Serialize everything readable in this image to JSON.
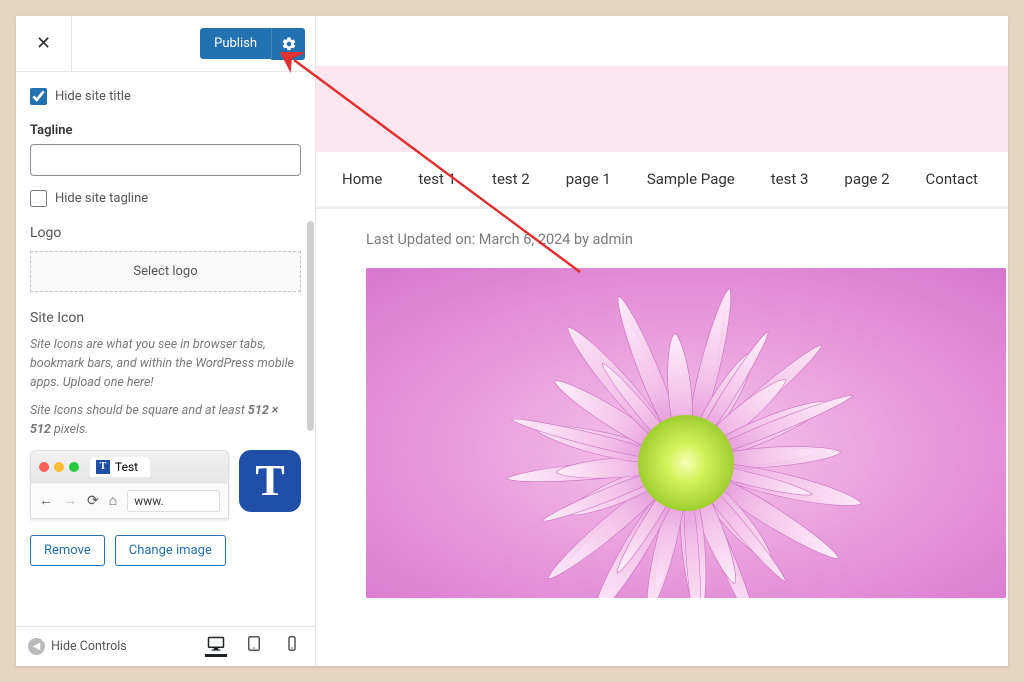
{
  "topbar": {
    "publish_label": "Publish"
  },
  "panel": {
    "hide_title_label": "Hide site title",
    "hide_title_checked": true,
    "tagline_label": "Tagline",
    "tagline_value": "",
    "hide_tagline_label": "Hide site tagline",
    "hide_tagline_checked": false,
    "logo_label": "Logo",
    "select_logo_label": "Select logo",
    "site_icon_label": "Site Icon",
    "site_icon_desc1": "Site Icons are what you see in browser tabs, bookmark bars, and within the WordPress mobile apps. Upload one here!",
    "site_icon_desc2_pre": "Site Icons should be square and at least ",
    "site_icon_size": "512 × 512",
    "site_icon_desc2_post": " pixels.",
    "tab_title": "Test",
    "tab_icon_letter": "T",
    "url_text": "www.",
    "big_icon_letter": "T",
    "remove_label": "Remove",
    "change_image_label": "Change image"
  },
  "bottom": {
    "hide_controls_label": "Hide Controls"
  },
  "preview": {
    "nav_items": [
      "Home",
      "test 1",
      "test 2",
      "page 1",
      "Sample Page",
      "test 3",
      "page 2",
      "Contact"
    ],
    "last_updated": "Last Updated on: March 6, 2024 by admin"
  },
  "colors": {
    "primary_blue": "#2271b1",
    "pink_band": "#fce6ef",
    "favicon_blue": "#1f4fa6",
    "arrow_red": "#e03030"
  }
}
